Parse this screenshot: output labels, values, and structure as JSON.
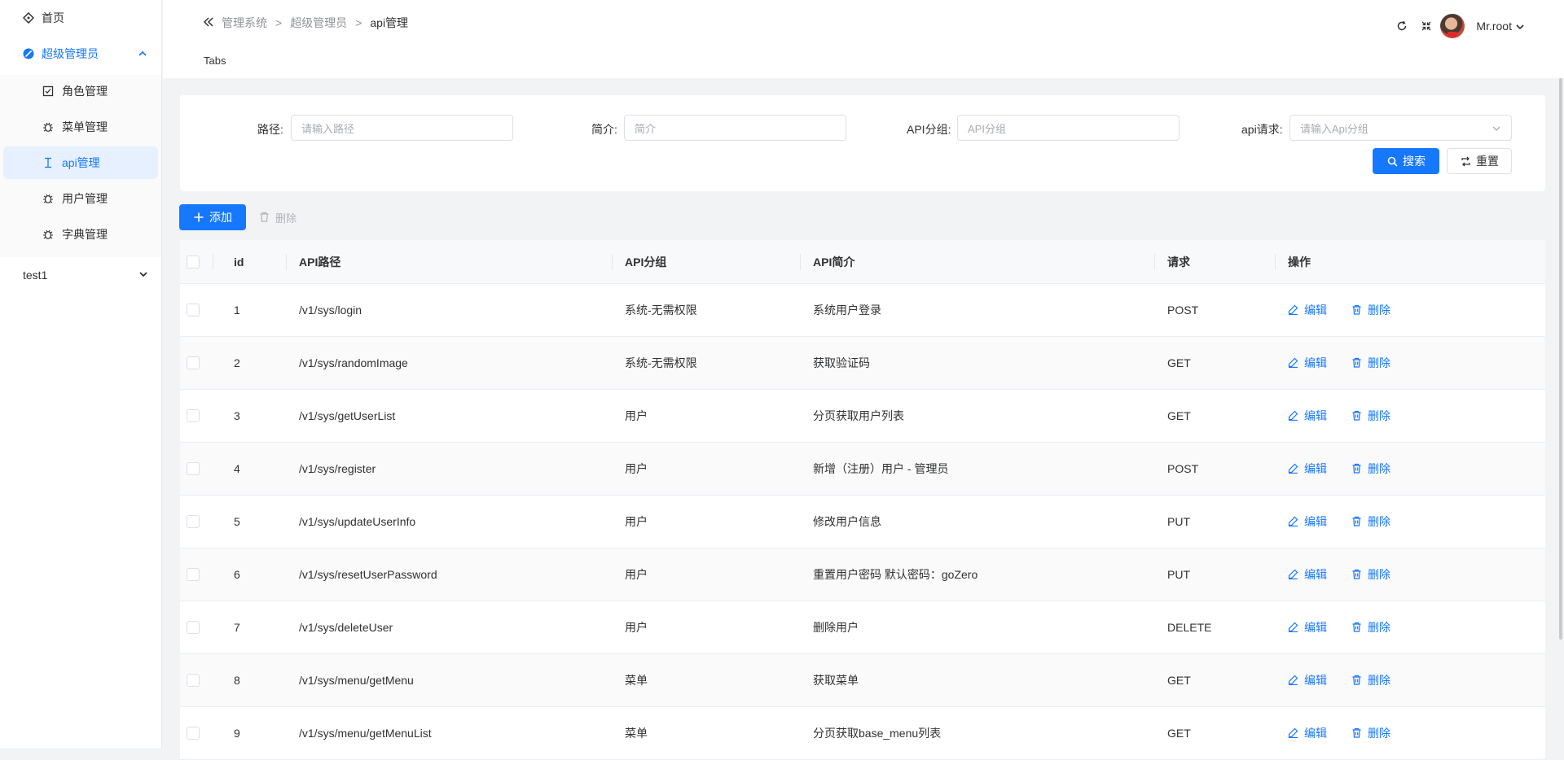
{
  "sidebar": {
    "home_label": "首页",
    "group_label": "超级管理员",
    "sub_items": [
      {
        "label": "角色管理",
        "icon": "checkbox-icon",
        "active": false
      },
      {
        "label": "菜单管理",
        "icon": "bug-icon",
        "active": false
      },
      {
        "label": "api管理",
        "icon": "text-cursor-icon",
        "active": true
      },
      {
        "label": "用户管理",
        "icon": "bug-icon",
        "active": false
      },
      {
        "label": "字典管理",
        "icon": "bug-icon",
        "active": false
      }
    ],
    "test_label": "test1"
  },
  "header": {
    "breadcrumb": [
      "管理系统",
      "超级管理员",
      "api管理"
    ],
    "username": "Mr.root",
    "tabs_label": "Tabs"
  },
  "search": {
    "path_label": "路径:",
    "path_placeholder": "请输入路径",
    "desc_label": "简介:",
    "desc_placeholder": "简介",
    "group_label": "API分组:",
    "group_placeholder": "API分组",
    "method_label": "api请求:",
    "method_placeholder": "请输入Api分组",
    "search_btn": "搜索",
    "reset_btn": "重置"
  },
  "toolbar": {
    "add_label": "添加",
    "delete_label": "删除"
  },
  "table": {
    "headers": {
      "id": "id",
      "path": "API路径",
      "group": "API分组",
      "desc": "API简介",
      "method": "请求",
      "ops": "操作"
    },
    "edit_label": "编辑",
    "delete_label": "删除",
    "rows": [
      {
        "id": "1",
        "path": "/v1/sys/login",
        "group": "系统-无需权限",
        "desc": "系统用户登录",
        "method": "POST"
      },
      {
        "id": "2",
        "path": "/v1/sys/randomImage",
        "group": "系统-无需权限",
        "desc": "获取验证码",
        "method": "GET"
      },
      {
        "id": "3",
        "path": "/v1/sys/getUserList",
        "group": "用户",
        "desc": "分页获取用户列表",
        "method": "GET"
      },
      {
        "id": "4",
        "path": "/v1/sys/register",
        "group": "用户",
        "desc": "新增（注册）用户 - 管理员",
        "method": "POST"
      },
      {
        "id": "5",
        "path": "/v1/sys/updateUserInfo",
        "group": "用户",
        "desc": "修改用户信息",
        "method": "PUT"
      },
      {
        "id": "6",
        "path": "/v1/sys/resetUserPassword",
        "group": "用户",
        "desc": "重置用户密码 默认密码：goZero",
        "method": "PUT"
      },
      {
        "id": "7",
        "path": "/v1/sys/deleteUser",
        "group": "用户",
        "desc": "删除用户",
        "method": "DELETE"
      },
      {
        "id": "8",
        "path": "/v1/sys/menu/getMenu",
        "group": "菜单",
        "desc": "获取菜单",
        "method": "GET"
      },
      {
        "id": "9",
        "path": "/v1/sys/menu/getMenuList",
        "group": "菜单",
        "desc": "分页获取base_menu列表",
        "method": "GET"
      }
    ]
  },
  "colors": {
    "primary": "#1677ff",
    "active_bg": "#e6f0ff"
  }
}
